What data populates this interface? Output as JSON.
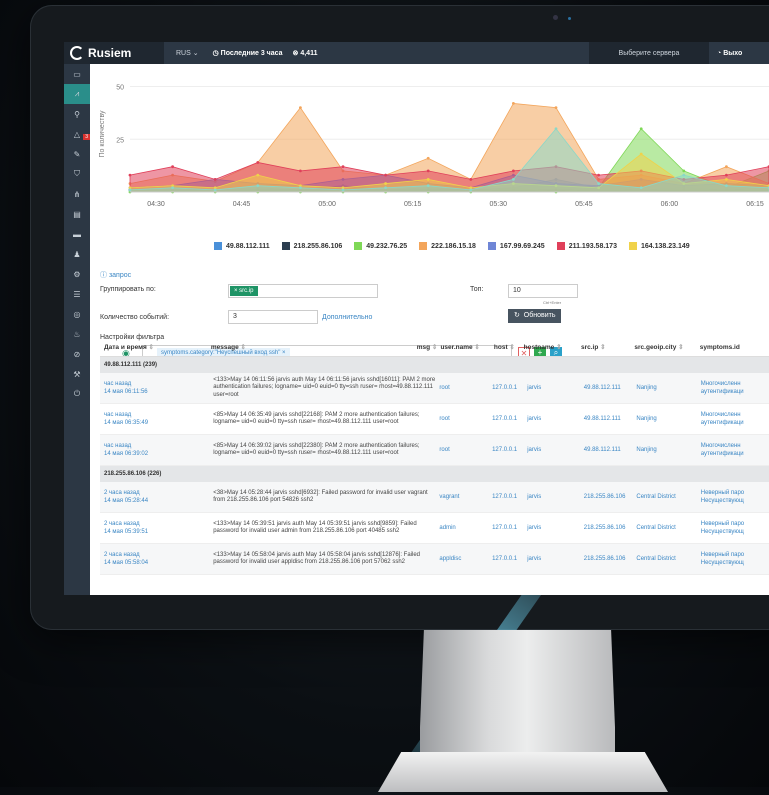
{
  "topbar": {
    "app_name": "Rusiem",
    "language": "RUS",
    "period": "Последние 3 часа",
    "event_count": "4,411",
    "servers_placeholder": "Выберите сервера",
    "logout": "Выхо"
  },
  "sidebar": {
    "items": [
      "monitor-icon",
      "chart-icon",
      "network-icon",
      "alert-icon",
      "tools-icon",
      "shield-icon",
      "hierarchy-icon",
      "database-icon",
      "truck-icon",
      "users-icon",
      "gear-icon",
      "list-icon",
      "target-icon",
      "fire-icon",
      "block-icon",
      "wrench-icon",
      "power-icon"
    ],
    "alert_badge": "3"
  },
  "chart_data": {
    "type": "area",
    "ylabel": "По количеству",
    "yticks": [
      "25",
      "50"
    ],
    "ylim": [
      0,
      55
    ],
    "x": [
      "04:30",
      "04:45",
      "05:00",
      "05:15",
      "05:30",
      "05:45",
      "06:00",
      "06:15"
    ],
    "series": [
      {
        "name": "49.88.112.111",
        "color": "#4a90d9",
        "values": [
          1,
          2,
          1,
          2,
          1,
          3,
          1,
          2,
          1,
          2,
          6,
          2,
          1,
          2,
          1,
          2
        ]
      },
      {
        "name": "218.255.86.106",
        "color": "#2c3e50",
        "values": [
          1,
          1,
          1,
          1,
          1,
          1,
          1,
          1,
          1,
          1,
          1,
          1,
          1,
          1,
          1,
          1
        ]
      },
      {
        "name": "49.232.76.25",
        "color": "#7fd857",
        "values": [
          0,
          0,
          0,
          0,
          0,
          0,
          0,
          0,
          0,
          2,
          0,
          2,
          30,
          10,
          2,
          10
        ]
      },
      {
        "name": "222.186.15.18",
        "color": "#f3a55b",
        "values": [
          4,
          8,
          5,
          14,
          40,
          10,
          8,
          16,
          6,
          42,
          40,
          6,
          8,
          4,
          12,
          4
        ]
      },
      {
        "name": "167.99.69.245",
        "color": "#6f86d6",
        "values": [
          2,
          3,
          6,
          4,
          3,
          6,
          8,
          4,
          2,
          8,
          4,
          3,
          6,
          3,
          4,
          3
        ]
      },
      {
        "name": "211.193.58.173",
        "color": "#e0405a",
        "values": [
          8,
          12,
          6,
          14,
          10,
          12,
          8,
          10,
          6,
          10,
          12,
          8,
          10,
          6,
          8,
          12
        ]
      },
      {
        "name": "164.138.23.149",
        "color": "#f0d24a",
        "values": [
          2,
          3,
          2,
          8,
          3,
          2,
          4,
          6,
          2,
          4,
          3,
          2,
          18,
          4,
          6,
          3
        ]
      },
      {
        "name": "",
        "color": "#8ad8c8",
        "values": [
          1,
          2,
          1,
          3,
          2,
          1,
          2,
          3,
          1,
          6,
          30,
          4,
          2,
          8,
          3,
          2
        ]
      }
    ]
  },
  "legend": [
    "49.88.112.111",
    "218.255.86.106",
    "49.232.76.25",
    "222.186.15.18",
    "167.99.69.245",
    "211.193.58.173",
    "164.138.23.149"
  ],
  "form": {
    "query_link": "запрос",
    "group_by_label": "Группировать по:",
    "group_by_tag": "src.ip",
    "top_label": "Топ:",
    "top_value": "10",
    "ctrl_enter": "Ctrl+Enter",
    "event_count_label": "Количество событий:",
    "event_count_value": "3",
    "additional_link": "Дополнительно",
    "refresh_button": "Обновить",
    "filter_settings_label": "Настройки фильтра",
    "filter_chip": "symptoms.category:\"Неуспешный вход ssh\""
  },
  "table": {
    "headers": [
      "Дата и время",
      "message",
      "msg",
      "user.name",
      "host",
      "hostname",
      "src.ip",
      "src.geoip.city",
      "symptoms.id"
    ],
    "groups": [
      {
        "title": "49.88.112.111 (239)",
        "rows": [
          {
            "ago": "час назад",
            "date": "14 мая 06:11:56",
            "msg": "<133>May 14 06:11:56 jarvis auth May 14 06:11:56 jarvis sshd[16011]: PAM 2 more authentication failures; logname= uid=0 euid=0 tty=ssh ruser= rhost=49.88.112.111 user=root",
            "user": "root",
            "host": "127.0.0.1",
            "hostname": "jarvis",
            "ip": "49.88.112.111",
            "city": "Nanjing",
            "sym1": "Многочисленн",
            "sym2": "аутентификаци"
          },
          {
            "ago": "час назад",
            "date": "14 мая 06:35:49",
            "msg": "<85>May 14 06:35:49 jarvis sshd[22168]: PAM 2 more authentication failures; logname= uid=0 euid=0 tty=ssh ruser= rhost=49.88.112.111 user=root",
            "user": "root",
            "host": "127.0.0.1",
            "hostname": "jarvis",
            "ip": "49.88.112.111",
            "city": "Nanjing",
            "sym1": "Многочисленн",
            "sym2": "аутентификаци"
          },
          {
            "ago": "час назад",
            "date": "14 мая 06:39:02",
            "msg": "<85>May 14 06:39:02 jarvis sshd[22380]: PAM 2 more authentication failures; logname= uid=0 euid=0 tty=ssh ruser= rhost=49.88.112.111 user=root",
            "user": "root",
            "host": "127.0.0.1",
            "hostname": "jarvis",
            "ip": "49.88.112.111",
            "city": "Nanjing",
            "sym1": "Многочисленн",
            "sym2": "аутентификаци"
          }
        ]
      },
      {
        "title": "218.255.86.106 (226)",
        "rows": [
          {
            "ago": "2 часа назад",
            "date": "14 мая 05:28:44",
            "msg": "<38>May 14 05:28:44 jarvis sshd[6932]: Failed password for invalid user vagrant from 218.255.86.106 port 54826 ssh2",
            "user": "vagrant",
            "host": "127.0.0.1",
            "hostname": "jarvis",
            "ip": "218.255.86.106",
            "city": "Central District",
            "sym1": "Неверный паро",
            "sym2": "Несуществующ"
          },
          {
            "ago": "2 часа назад",
            "date": "14 мая 05:39:51",
            "msg": "<133>May 14 05:39:51 jarvis auth May 14 05:39:51 jarvis sshd[9859]: Failed password for invalid user admin from 218.255.86.106 port 40485 ssh2",
            "user": "admin",
            "host": "127.0.0.1",
            "hostname": "jarvis",
            "ip": "218.255.86.106",
            "city": "Central District",
            "sym1": "Неверный паро",
            "sym2": "Несуществующ"
          },
          {
            "ago": "2 часа назад",
            "date": "14 мая 05:58:04",
            "msg": "<133>May 14 05:58:04 jarvis auth May 14 05:58:04 jarvis sshd[12876]: Failed password for invalid user appldisc from 218.255.86.106 port 57062 ssh2",
            "user": "appldisc",
            "host": "127.0.0.1",
            "hostname": "jarvis",
            "ip": "218.255.86.106",
            "city": "Central District",
            "sym1": "Неверный паро",
            "sym2": "Несуществующ"
          }
        ]
      }
    ]
  }
}
